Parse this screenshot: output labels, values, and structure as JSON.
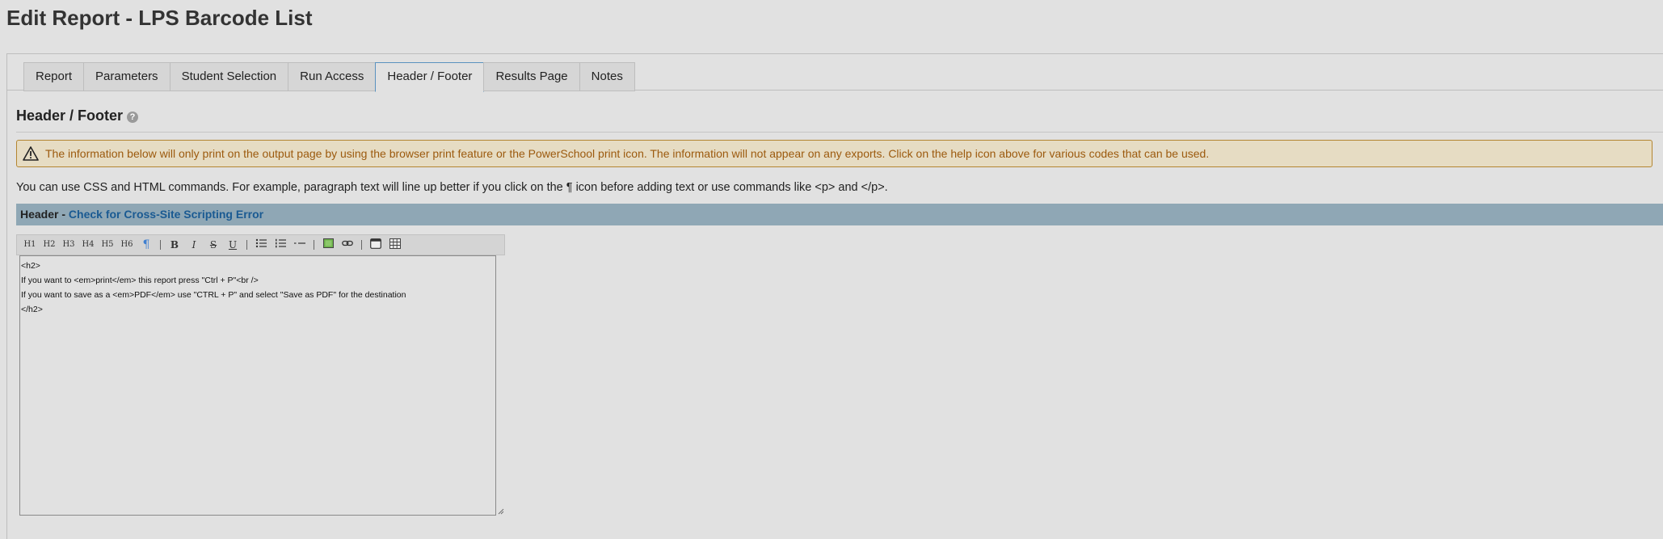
{
  "page": {
    "title": "Edit Report - LPS Barcode List"
  },
  "tabs": [
    {
      "label": "Report",
      "active": false
    },
    {
      "label": "Parameters",
      "active": false
    },
    {
      "label": "Student Selection",
      "active": false
    },
    {
      "label": "Run Access",
      "active": false
    },
    {
      "label": "Header / Footer",
      "active": true
    },
    {
      "label": "Results Page",
      "active": false
    },
    {
      "label": "Notes",
      "active": false
    }
  ],
  "section": {
    "heading": "Header / Footer",
    "help_icon": "?"
  },
  "warning": {
    "text": "The information below will only print on the output page by using the browser print feature or the PowerSchool print icon. The information will not appear on any exports. Click on the help icon above for various codes that can be used."
  },
  "info": {
    "text": "You can use CSS and HTML commands. For example, paragraph text will line up better if you click on the ¶ icon before adding text or use commands like <p> and </p>."
  },
  "header_bar": {
    "label": "Header - ",
    "link": "Check for Cross-Site Scripting Error"
  },
  "toolbar": {
    "h1": "H1",
    "h2": "H2",
    "h3": "H3",
    "h4": "H4",
    "h5": "H5",
    "h6": "H6",
    "paragraph": "¶",
    "bold": "B",
    "italic": "I",
    "strike": "S",
    "underline": "U"
  },
  "editor": {
    "content": "<h2>\nIf you want to <em>print</em> this report press \"Ctrl + P\"<br />\nIf you want to save as a <em>PDF</em> use \"CTRL + P\" and select \"Save as PDF\" for the destination\n</h2>"
  },
  "colors": {
    "warning_bg": "#e6dcc3",
    "warning_border": "#b48631",
    "warning_text": "#9c5a0e",
    "header_bar_bg": "#8fa7b5",
    "link": "#1a5a92",
    "active_tab_border": "#5a92bf"
  }
}
